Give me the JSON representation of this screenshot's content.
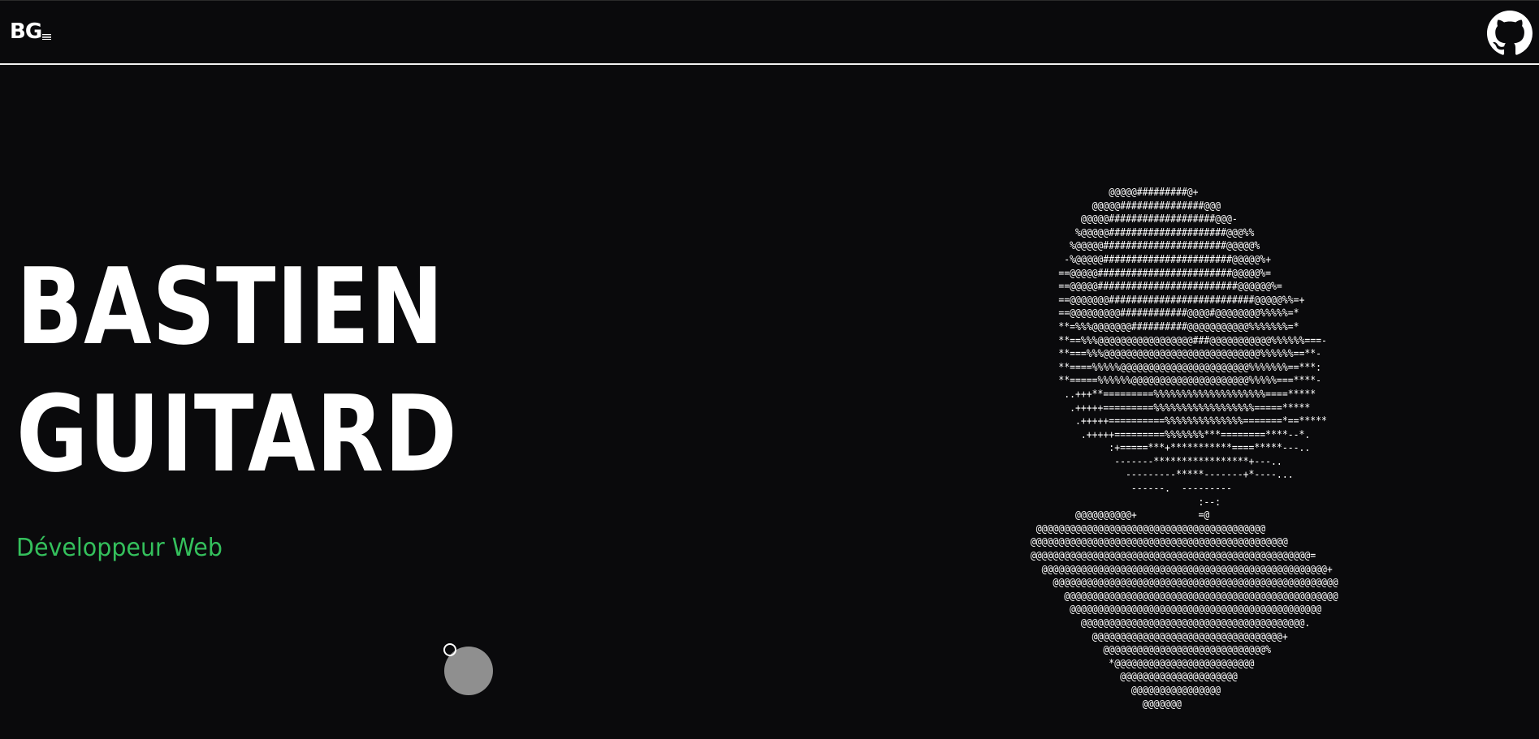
{
  "nav": {
    "logo_text": "BG",
    "github_icon": "github-icon"
  },
  "hero": {
    "first_name": "BASTIEN",
    "last_name": "GUITARD",
    "subtitle": "Développeur Web"
  },
  "ascii_portrait": "               @@@@@#########@+\n            @@@@@###############@@@\n          @@@@@###################@@@-\n         %@@@@@#####################@@@%%\n        %@@@@@######################@@@@@%\n       -%@@@@@#######################@@@@@%+\n      ==@@@@@########################@@@@@%=\n      ==@@@@@#########################@@@@@@%=\n      ==@@@@@@@##########################@@@@@%%=+\n      ==@@@@@@@@@############@@@@#@@@@@@@@%%%%%=*\n      **=%%%@@@@@@@##########@@@@@@@@@@@%%%%%%%=*\n      **==%%%@@@@@@@@@@@@@@@@@###@@@@@@@@@@@%%%%%%===-\n      **===%%%@@@@@@@@@@@@@@@@@@@@@@@@@@@@%%%%%%==**-\n      **====%%%%%@@@@@@@@@@@@@@@@@@@@@@@%%%%%%%==***:\n      **=====%%%%%%@@@@@@@@@@@@@@@@@@@@@%%%%%===****-\n       ..+++**=========%%%%%%%%%%%%%%%%%%%%====*****\n        .+++++=========%%%%%%%%%%%%%%%%%%=====*****\n         .+++++==========%%%%%%%%%%%%%%=======*==*****\n          .+++++=========%%%%%%%***========****--*.\n               :+=====***+***********====*****---..\n                -------*****************+---..\n                  ---------*****-------+*----...\n                   ------.  ---------\n                               :--:\n         @@@@@@@@@@+           =@\n  @@@@@@@@@@@@@@@@@@@@@@@@@@@@@@@@@@@@@@@@@\n @@@@@@@@@@@@@@@@@@@@@@@@@@@@@@@@@@@@@@@@@@@@@@\n @@@@@@@@@@@@@@@@@@@@@@@@@@@@@@@@@@@@@@@@@@@@@@@@@@=\n   @@@@@@@@@@@@@@@@@@@@@@@@@@@@@@@@@@@@@@@@@@@@@@@@@@@+\n     @@@@@@@@@@@@@@@@@@@@@@@@@@@@@@@@@@@@@@@@@@@@@@@@@@@\n       @@@@@@@@@@@@@@@@@@@@@@@@@@@@@@@@@@@@@@@@@@@@@@@@@\n        @@@@@@@@@@@@@@@@@@@@@@@@@@@@@@@@@@@@@@@@@@@@@\n          @@@@@@@@@@@@@@@@@@@@@@@@@@@@@@@@@@@@@@@@.\n            @@@@@@@@@@@@@@@@@@@@@@@@@@@@@@@@@@+\n              @@@@@@@@@@@@@@@@@@@@@@@@@@@@@%\n               *@@@@@@@@@@@@@@@@@@@@@@@@@\n                 @@@@@@@@@@@@@@@@@@@@@\n                   @@@@@@@@@@@@@@@@\n                     @@@@@@@"
}
